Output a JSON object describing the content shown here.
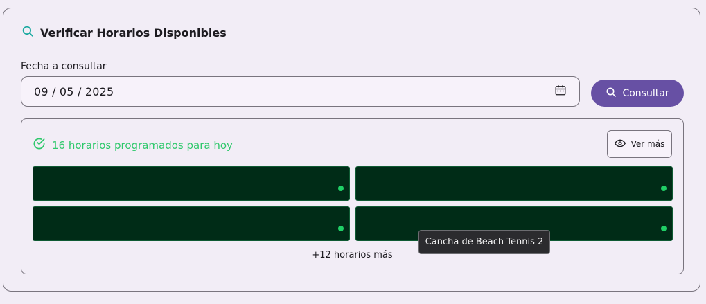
{
  "panel": {
    "title": "Verificar Horarios Disponibles",
    "title_icon": "search-icon"
  },
  "date": {
    "label": "Fecha a consultar",
    "value": "09 / 05 / 2025",
    "icon": "calendar-icon"
  },
  "consult_button": {
    "label": "Consultar",
    "icon": "search-icon"
  },
  "results": {
    "status_text": "16 horarios programados para hoy",
    "status_icon": "check-circle-icon",
    "more_button_label": "Ver más",
    "more_button_icon": "eye-icon",
    "more_text": "+12 horarios más"
  },
  "tooltip": {
    "text": "Cancha de Beach Tennis 2"
  },
  "colors": {
    "accent": "#6750a4",
    "success": "#2ec86b",
    "slot_bg": "#002c17",
    "dot": "#1fcf66"
  }
}
